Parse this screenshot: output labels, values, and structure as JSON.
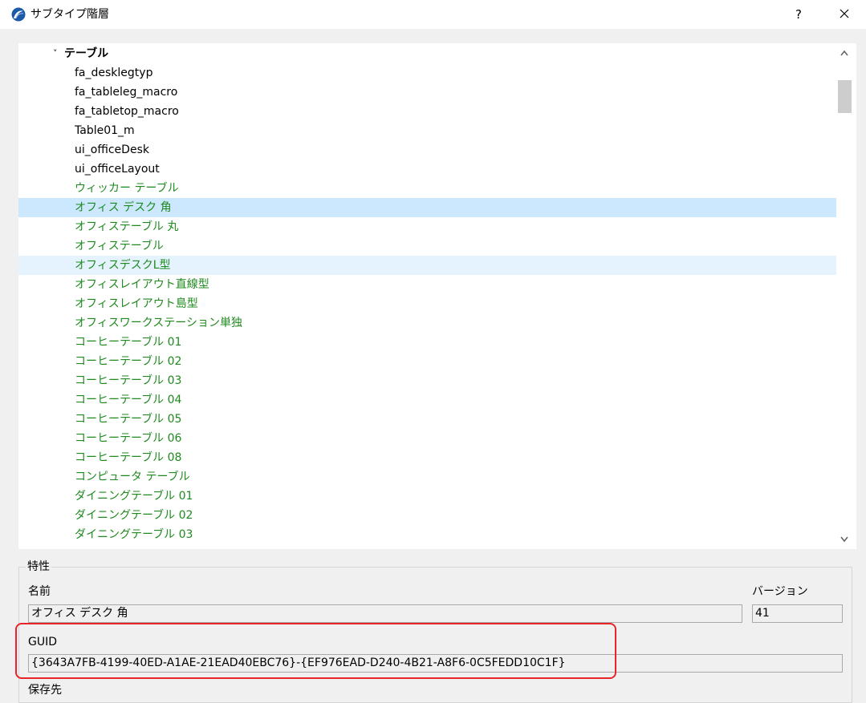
{
  "window": {
    "title": "サブタイプ階層",
    "help_label": "?"
  },
  "tree": {
    "group_label": "テーブル",
    "items": [
      {
        "label": "fa_desklegtyp",
        "color": "black"
      },
      {
        "label": "fa_tableleg_macro",
        "color": "black"
      },
      {
        "label": "fa_tabletop_macro",
        "color": "black"
      },
      {
        "label": "Table01_m",
        "color": "black"
      },
      {
        "label": "ui_officeDesk",
        "color": "black"
      },
      {
        "label": "ui_officeLayout",
        "color": "black"
      },
      {
        "label": "ウィッカー テーブル",
        "color": "green"
      },
      {
        "label": "オフィス デスク 角",
        "color": "green",
        "state": "selected"
      },
      {
        "label": "オフィステーブル 丸",
        "color": "green"
      },
      {
        "label": "オフィステーブル",
        "color": "green"
      },
      {
        "label": "オフィスデスクL型",
        "color": "green",
        "state": "hover"
      },
      {
        "label": "オフィスレイアウト直線型",
        "color": "green"
      },
      {
        "label": "オフィスレイアウト島型",
        "color": "green"
      },
      {
        "label": "オフィスワークステーション単独",
        "color": "green"
      },
      {
        "label": "コーヒーテーブル 01",
        "color": "green"
      },
      {
        "label": "コーヒーテーブル 02",
        "color": "green"
      },
      {
        "label": "コーヒーテーブル 03",
        "color": "green"
      },
      {
        "label": "コーヒーテーブル 04",
        "color": "green"
      },
      {
        "label": "コーヒーテーブル 05",
        "color": "green"
      },
      {
        "label": "コーヒーテーブル 06",
        "color": "green"
      },
      {
        "label": "コーヒーテーブル 08",
        "color": "green"
      },
      {
        "label": "コンピュータ テーブル",
        "color": "green"
      },
      {
        "label": "ダイニングテーブル 01",
        "color": "green"
      },
      {
        "label": "ダイニングテーブル 02",
        "color": "green"
      },
      {
        "label": "ダイニングテーブル 03",
        "color": "green"
      }
    ],
    "colors": {
      "black": "#000000",
      "green": "#1e8a1e",
      "selected": "#cce8ff",
      "hover": "#e5f3ff"
    }
  },
  "properties": {
    "group_title": "特性",
    "name_label": "名前",
    "name_value": "オフィス デスク 角",
    "version_label": "バージョン",
    "version_value": "41",
    "guid_label": "GUID",
    "guid_value": "{3643A7FB-4199-40ED-A1AE-21EAD40EBC76}-{EF976EAD-D240-4B21-A8F6-0C5FEDD10C1F}",
    "next_label": "保存先"
  }
}
